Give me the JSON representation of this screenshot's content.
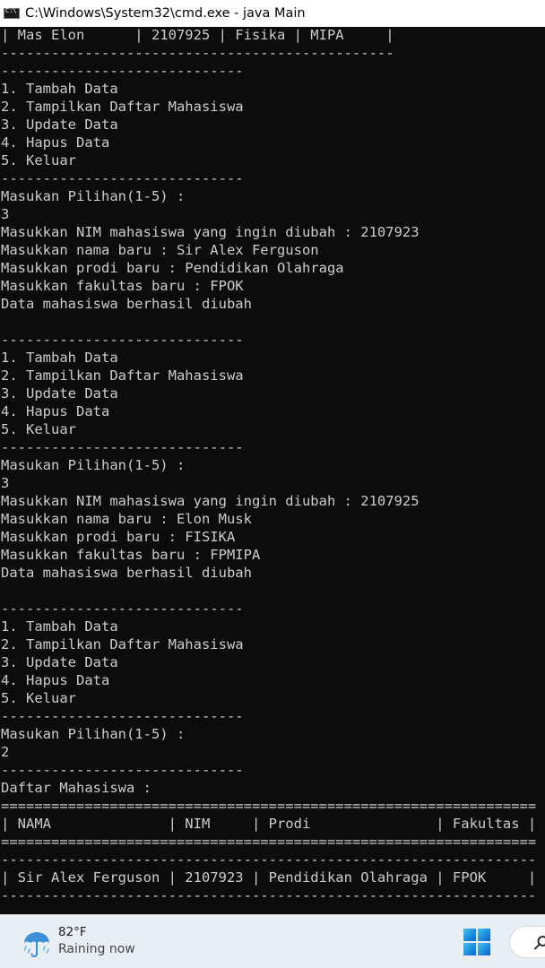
{
  "window": {
    "title": "C:\\Windows\\System32\\cmd.exe - java  Main",
    "icon": "console-app-icon"
  },
  "console": {
    "foreground": "#cccccc",
    "background": "#0c0c0c",
    "lines": [
      "| Mas Elon      | 2107925 | Fisika | MIPA     |",
      "-----------------------------------------------",
      "-----------------------------",
      "1. Tambah Data",
      "2. Tampilkan Daftar Mahasiswa",
      "3. Update Data",
      "4. Hapus Data",
      "5. Keluar",
      "-----------------------------",
      "Masukan Pilihan(1-5) :",
      "3",
      "Masukkan NIM mahasiswa yang ingin diubah : 2107923",
      "Masukkan nama baru : Sir Alex Ferguson",
      "Masukkan prodi baru : Pendidikan Olahraga",
      "Masukkan fakultas baru : FPOK",
      "Data mahasiswa berhasil diubah",
      "",
      "-----------------------------",
      "1. Tambah Data",
      "2. Tampilkan Daftar Mahasiswa",
      "3. Update Data",
      "4. Hapus Data",
      "5. Keluar",
      "-----------------------------",
      "Masukan Pilihan(1-5) :",
      "3",
      "Masukkan NIM mahasiswa yang ingin diubah : 2107925",
      "Masukkan nama baru : Elon Musk",
      "Masukkan prodi baru : FISIKA",
      "Masukkan fakultas baru : FPMIPA",
      "Data mahasiswa berhasil diubah",
      "",
      "-----------------------------",
      "1. Tambah Data",
      "2. Tampilkan Daftar Mahasiswa",
      "3. Update Data",
      "4. Hapus Data",
      "5. Keluar",
      "-----------------------------",
      "Masukan Pilihan(1-5) :",
      "2",
      "-----------------------------",
      "Daftar Mahasiswa :",
      "================================================================",
      "| NAMA              | NIM     | Prodi               | Fakultas |",
      "================================================================",
      "----------------------------------------------------------------",
      "| Sir Alex Ferguson | 2107923 | Pendidikan Olahraga | FPOK     |",
      "----------------------------------------------------------------"
    ]
  },
  "taskbar": {
    "weather": {
      "temperature": "82°F",
      "condition": "Raining now",
      "icon": "rain-umbrella-icon"
    },
    "start_icon": "windows-start-icon",
    "search_icon": "search-icon"
  }
}
